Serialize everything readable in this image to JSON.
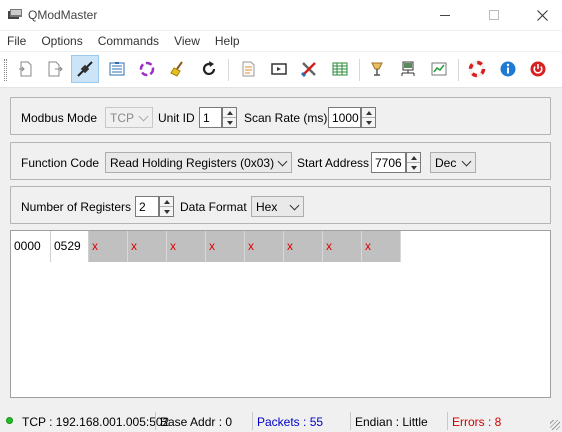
{
  "window": {
    "title": "QModMaster"
  },
  "menu": [
    {
      "label": "File"
    },
    {
      "label": "Options"
    },
    {
      "label": "Commands"
    },
    {
      "label": "View"
    },
    {
      "label": "Help"
    }
  ],
  "toolbar": {
    "active_tool": "connect",
    "tools": [
      "load-session-icon",
      "save-session-icon",
      "connect-icon",
      "read-write-icon",
      "scan-icon",
      "reset-counters-icon",
      "clear-icon",
      "refresh-icon",
      "log-icon",
      "bus-monitor-icon",
      "tools-icon",
      "register-table-icon",
      "settings-icon",
      "rtu-settings-icon",
      "tcp-settings-icon",
      "help-icon",
      "about-icon",
      "exit-icon"
    ]
  },
  "mode_group": {
    "modbus_mode_label": "Modbus Mode",
    "modbus_mode_value": "TCP",
    "unit_id_label": "Unit ID",
    "unit_id_value": "1",
    "scan_rate_label": "Scan Rate (ms)",
    "scan_rate_value": "1000"
  },
  "function_group": {
    "function_code_label": "Function Code",
    "function_code_value": "Read Holding Registers (0x03)",
    "start_address_label": "Start Address",
    "start_address_value": "7706",
    "address_format_value": "Dec"
  },
  "register_group": {
    "num_registers_label": "Number of Registers",
    "num_registers_value": "2",
    "data_format_label": "Data Format",
    "data_format_value": "Hex"
  },
  "data": {
    "address": "0000",
    "value": "0529",
    "empty_marker": "x"
  },
  "status": {
    "connection": "TCP : 192.168.001.005:502",
    "base_addr": "Base Addr : 0",
    "packets": "Packets : 55",
    "endian": "Endian : Little",
    "errors": "Errors : 8",
    "packets_color": "#0000c8",
    "errors_color": "#d00000"
  }
}
